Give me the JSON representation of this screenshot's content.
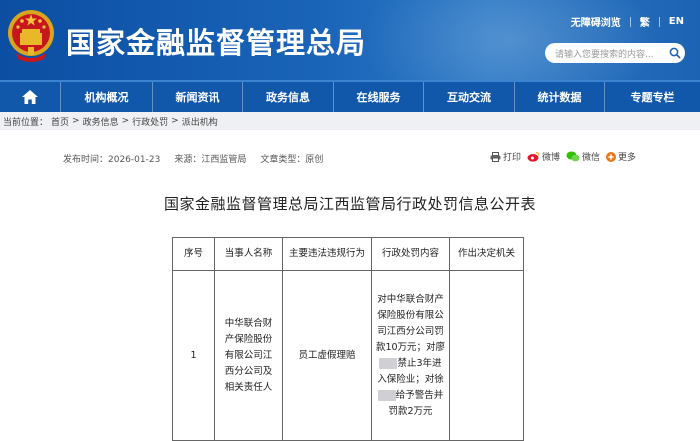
{
  "header": {
    "site_title": "国家金融监督管理总局",
    "toplinks": [
      "无障碍浏览",
      "繁",
      "EN"
    ],
    "search_placeholder": "请输入您要搜索的内容..."
  },
  "nav": {
    "items": [
      "机构概况",
      "新闻资讯",
      "政务信息",
      "在线服务",
      "互动交流",
      "统计数据",
      "专题专栏"
    ]
  },
  "breadcrumb": {
    "label": "当前位置：",
    "items": [
      "首页",
      "政务信息",
      "行政处罚",
      "派出机构"
    ],
    "separator": ">"
  },
  "article": {
    "publish_time": "发布时间：2026-01-23",
    "source": "来源：江西监管局",
    "doc_type": "文章类型：原创",
    "share": {
      "print": "打印",
      "weibo": "微博",
      "wechat": "微信",
      "more": "更多"
    },
    "title": "国家金融监督管理总局江西监管局行政处罚信息公开表"
  },
  "table": {
    "headers": [
      "序号",
      "当事人名称",
      "主要违法违规行为",
      "行政处罚内容",
      "作出决定机关"
    ],
    "rows": [
      {
        "no": "1",
        "party": "中华联合财产保险股份有限公司江西分公司及相关责任人",
        "violation": "员工虚假理赔",
        "penalty_1": "对中华联合财产保险股份有限公司江西分公司罚款10万元；对廖",
        "penalty_2": "禁止3年进入保险业；对徐",
        "penalty_3": "给予警告并罚款2万元",
        "authority": ""
      }
    ]
  }
}
